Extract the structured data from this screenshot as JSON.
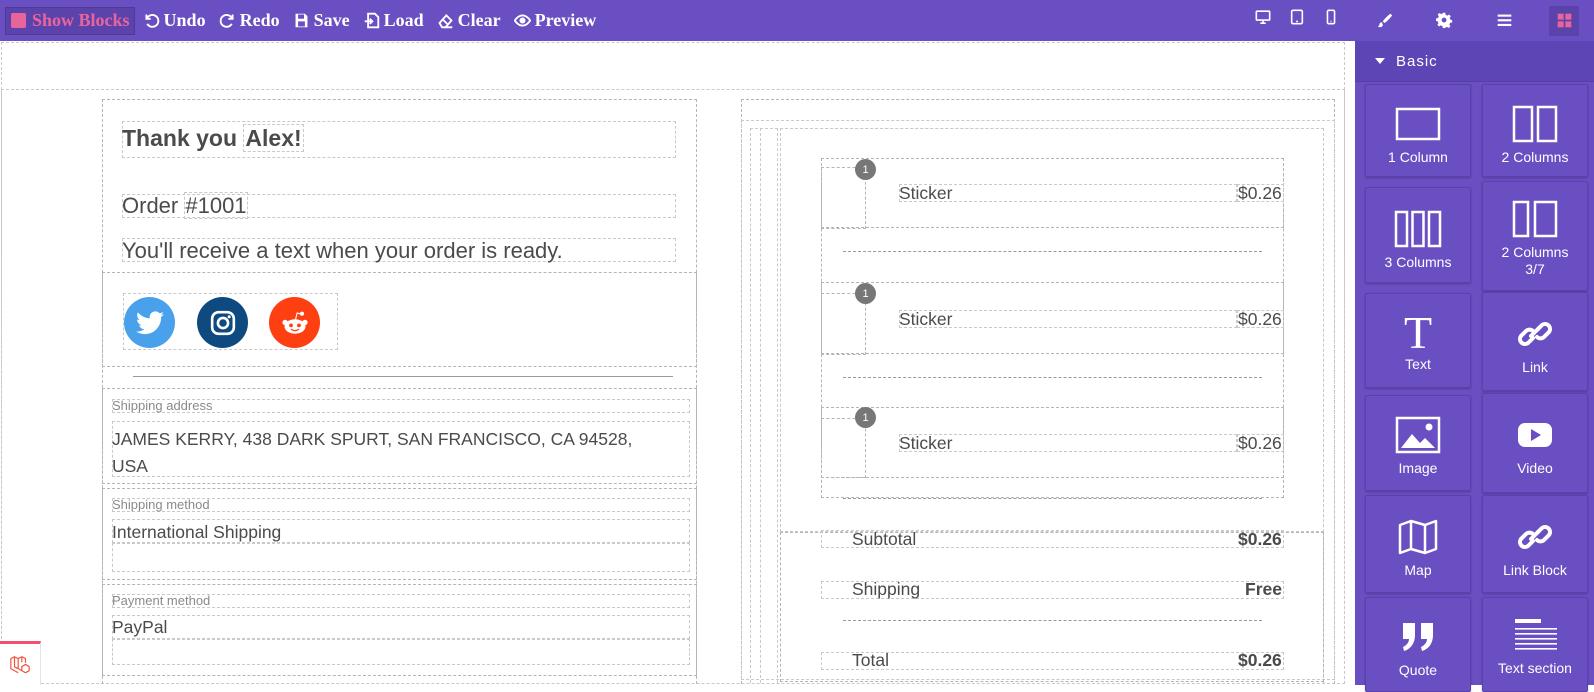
{
  "toolbar": {
    "show_blocks": "Show Blocks",
    "undo": "Undo",
    "redo": "Redo",
    "save": "Save",
    "load": "Load",
    "clear": "Clear",
    "preview": "Preview",
    "devices": [
      "desktop-icon",
      "tablet-icon",
      "mobile-icon"
    ]
  },
  "panel": {
    "tabs": [
      "brush-icon",
      "gear-icon",
      "layers-icon",
      "blocks-icon"
    ],
    "category": "Basic",
    "blocks": [
      {
        "label": "1 Column",
        "icon": "one-column-icon"
      },
      {
        "label": "2 Columns",
        "icon": "two-columns-icon"
      },
      {
        "label": "3 Columns",
        "icon": "three-columns-icon"
      },
      {
        "label": "2 Columns 3/7",
        "icon": "two-columns-37-icon"
      },
      {
        "label": "Text",
        "icon": "text-icon"
      },
      {
        "label": "Link",
        "icon": "link-icon"
      },
      {
        "label": "Image",
        "icon": "image-icon"
      },
      {
        "label": "Video",
        "icon": "video-icon"
      },
      {
        "label": "Map",
        "icon": "map-icon"
      },
      {
        "label": "Link Block",
        "icon": "link-block-icon"
      },
      {
        "label": "Quote",
        "icon": "quote-icon"
      },
      {
        "label": "Text section",
        "icon": "text-section-icon"
      }
    ]
  },
  "email": {
    "thank_you": "Thank you",
    "customer_name": "Alex!",
    "order_prefix": "Order ",
    "order_number": "#1001",
    "notice": "You'll receive a text when your order is ready.",
    "social": [
      "twitter-icon",
      "instagram-icon",
      "reddit-icon"
    ],
    "shipping_address_label": "Shipping address",
    "shipping_address": "JAMES KERRY, 438 DARK SPURT, SAN FRANCISCO, CA 94528, USA",
    "shipping_method_label": "Shipping method",
    "shipping_method": "International Shipping",
    "payment_method_label": "Payment method",
    "payment_method": "PayPal",
    "items": [
      {
        "qty": "1",
        "name": "Sticker",
        "price": "$0.26"
      },
      {
        "qty": "1",
        "name": "Sticker",
        "price": "$0.26"
      },
      {
        "qty": "1",
        "name": "Sticker",
        "price": "$0.26"
      }
    ],
    "subtotal_label": "Subtotal",
    "subtotal": "$0.26",
    "shipping_label": "Shipping",
    "shipping": "Free",
    "total_label": "Total",
    "total": "$0.26"
  },
  "colors": {
    "toolbar": "#6a4fc3",
    "accent": "#e8659c",
    "twitter": "#4aa1eb",
    "instagram": "#0e4a80",
    "reddit": "#fd3f12"
  }
}
